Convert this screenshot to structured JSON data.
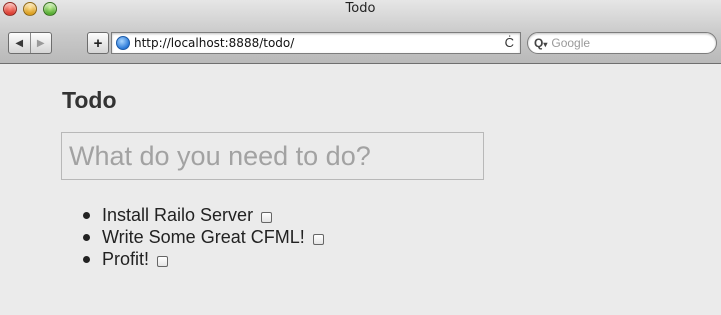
{
  "window": {
    "title": "Todo"
  },
  "toolbar": {
    "back_label": "◀",
    "forward_label": "▶",
    "add_label": "+",
    "url": "http://localhost:8888/todo/",
    "reload_label": "Ċ",
    "search_placeholder": "Google",
    "search_icon_label": "Q"
  },
  "page": {
    "heading": "Todo",
    "input_placeholder": "What do you need to do?",
    "todos": [
      {
        "label": "Install Railo Server",
        "checked": false
      },
      {
        "label": "Write Some Great CFML!",
        "checked": false
      },
      {
        "label": "Profit!",
        "checked": false
      }
    ]
  }
}
